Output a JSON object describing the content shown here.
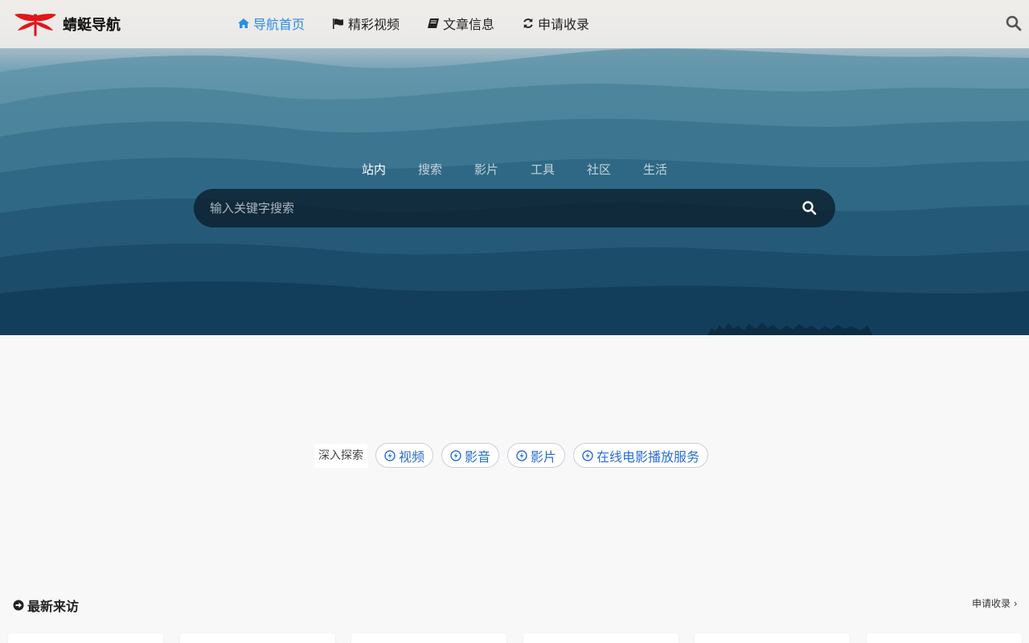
{
  "brand": {
    "name": "蜻蜓导航"
  },
  "nav": {
    "items": [
      {
        "label": "导航首页",
        "icon": "home-icon",
        "active": true
      },
      {
        "label": "精彩视频",
        "icon": "flag-icon",
        "active": false
      },
      {
        "label": "文章信息",
        "icon": "book-icon",
        "active": false
      },
      {
        "label": "申请收录",
        "icon": "refresh-icon",
        "active": false
      }
    ]
  },
  "search": {
    "tabs": [
      {
        "label": "站内",
        "active": true
      },
      {
        "label": "搜索",
        "active": false
      },
      {
        "label": "影片",
        "active": false
      },
      {
        "label": "工具",
        "active": false
      },
      {
        "label": "社区",
        "active": false
      },
      {
        "label": "生活",
        "active": false
      }
    ],
    "placeholder": "输入关键字搜索"
  },
  "explore": {
    "label": "深入探索",
    "chips": [
      "视频",
      "影音",
      "影片",
      "在线电影播放服务"
    ]
  },
  "section": {
    "title": "最新来访",
    "apply_link": "申请收录 ›"
  },
  "colors": {
    "accent": "#2b8ce6",
    "chip_text": "#2a6fcf",
    "logo_red": "#e0161b"
  }
}
